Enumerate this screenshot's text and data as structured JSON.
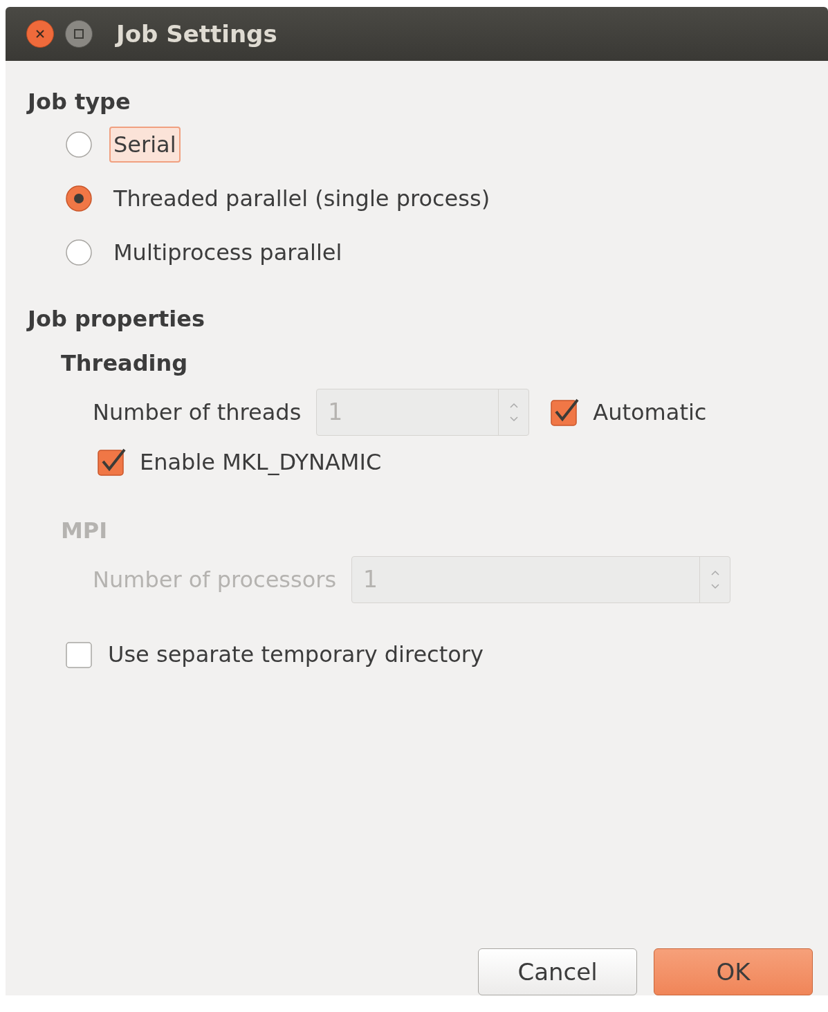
{
  "window": {
    "title": "Job Settings"
  },
  "job_type": {
    "heading": "Job type",
    "options": [
      {
        "label": "Serial",
        "selected": false,
        "focused": true
      },
      {
        "label": "Threaded parallel (single process)",
        "selected": true,
        "focused": false
      },
      {
        "label": "Multiprocess parallel",
        "selected": false,
        "focused": false
      }
    ]
  },
  "job_properties": {
    "heading": "Job properties",
    "threading": {
      "heading": "Threading",
      "disabled": false,
      "threads_label": "Number of threads",
      "threads_value": "1",
      "threads_disabled": true,
      "automatic": {
        "label": "Automatic",
        "checked": true
      },
      "mkl": {
        "label": "Enable MKL_DYNAMIC",
        "checked": true
      }
    },
    "mpi": {
      "heading": "MPI",
      "disabled": true,
      "processors_label": "Number of processors",
      "processors_value": "1"
    }
  },
  "temp_dir": {
    "label": "Use separate temporary directory",
    "checked": false
  },
  "buttons": [
    {
      "label": "Cancel",
      "default": false
    },
    {
      "label": "OK",
      "default": true
    }
  ]
}
